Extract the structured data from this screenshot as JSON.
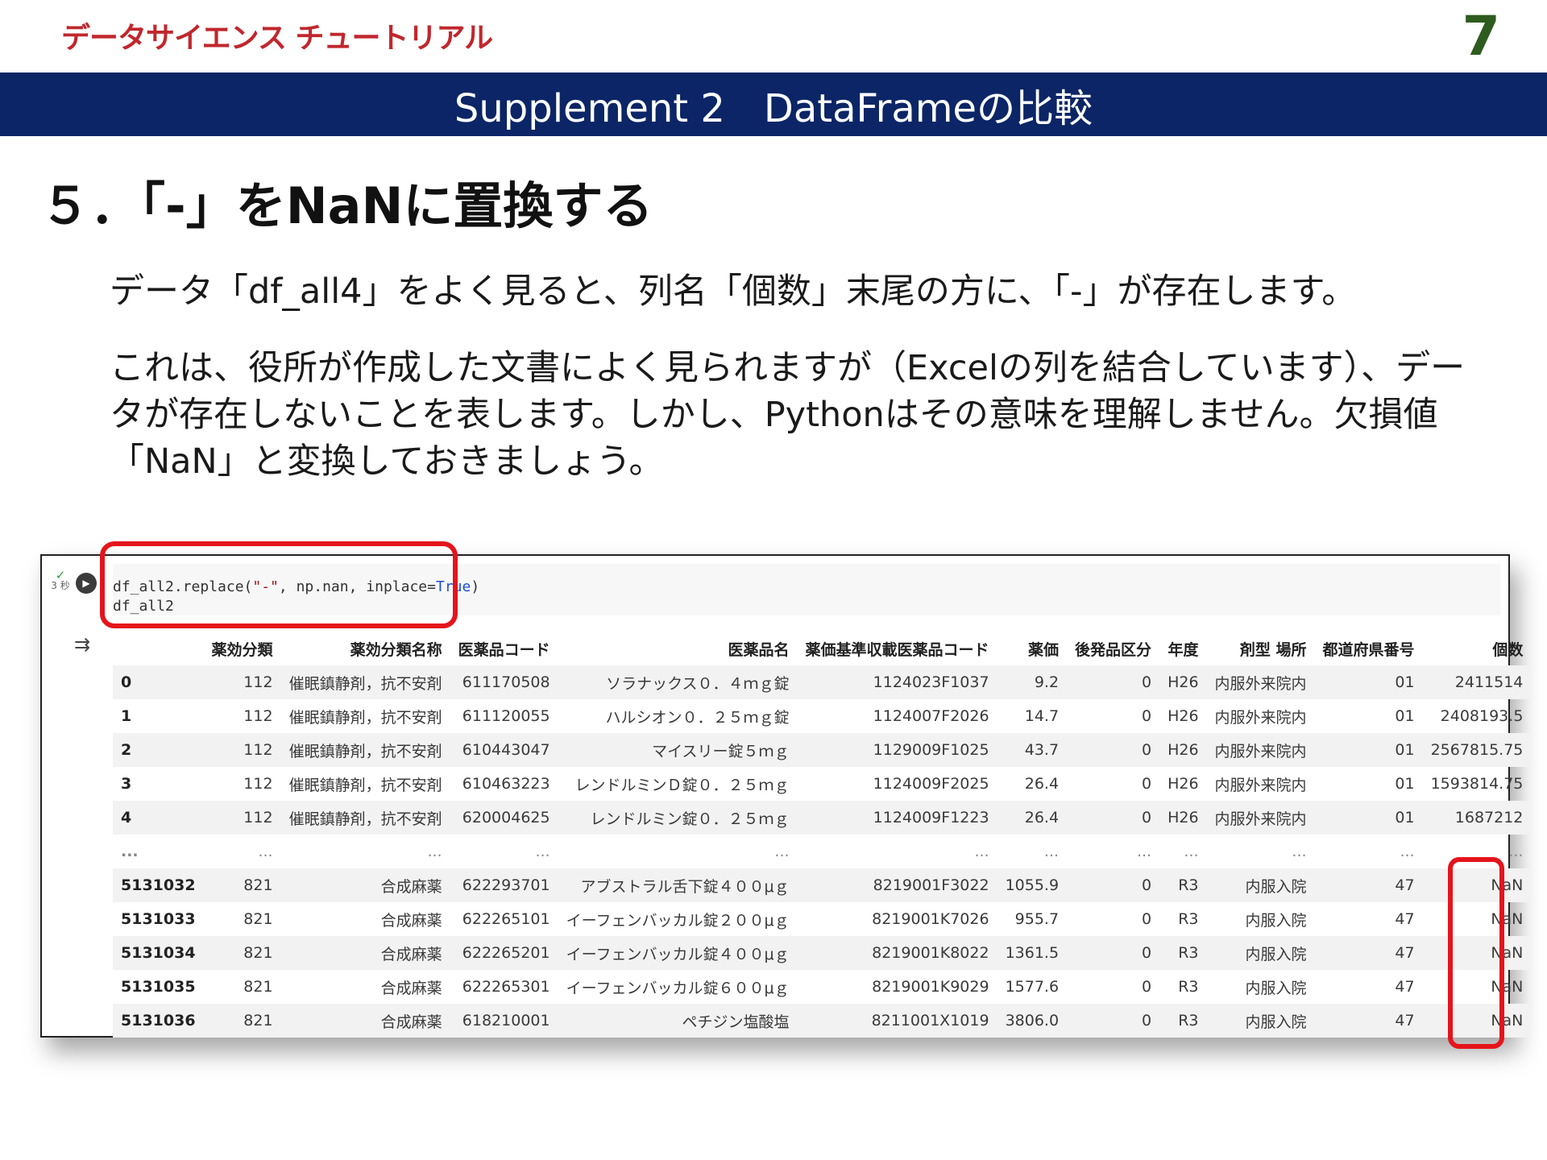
{
  "header": {
    "brand": "データサイエンス チュートリアル",
    "page_number": "7",
    "banner": "Supplement 2　DataFrameの比較"
  },
  "section": {
    "title": "５．「-」をNaNに置換する",
    "para1": "データ「df_all4」をよく見ると、列名「個数」末尾の方に、「-」が存在します。",
    "para2": "これは、役所が作成した文書によく見られますが（Excelの列を結合しています）、データが存在しないことを表します。しかし、Pythonはその意味を理解しません。欠損値「NaN」と変換しておきましょう。"
  },
  "cell": {
    "status_check": "✓",
    "status_time": "3 秒",
    "code_line1_a": "df_all2.replace(",
    "code_line1_str": "\"-\"",
    "code_line1_b": ", np.nan, inplace=",
    "code_line1_kw": "True",
    "code_line1_c": ")",
    "code_line2": "df_all2"
  },
  "table": {
    "columns": [
      "",
      "薬効分類",
      "薬効分類名称",
      "医薬品コード",
      "医薬品名",
      "薬価基準収載医薬品コード",
      "薬価",
      "後発品区分",
      "年度",
      "剤型 場所",
      "都道府県番号",
      "個数"
    ],
    "rows": [
      [
        "0",
        "112",
        "催眠鎮静剤，抗不安剤",
        "611170508",
        "ソラナックス０．４ｍｇ錠",
        "1124023F1037",
        "9.2",
        "0",
        "H26",
        "内服外来院内",
        "01",
        "2411514"
      ],
      [
        "1",
        "112",
        "催眠鎮静剤，抗不安剤",
        "611120055",
        "ハルシオン０．２５ｍｇ錠",
        "1124007F2026",
        "14.7",
        "0",
        "H26",
        "内服外来院内",
        "01",
        "2408193.5"
      ],
      [
        "2",
        "112",
        "催眠鎮静剤，抗不安剤",
        "610443047",
        "マイスリー錠５ｍｇ",
        "1129009F1025",
        "43.7",
        "0",
        "H26",
        "内服外来院内",
        "01",
        "2567815.75"
      ],
      [
        "3",
        "112",
        "催眠鎮静剤，抗不安剤",
        "610463223",
        "レンドルミンＤ錠０．２５ｍｇ",
        "1124009F2025",
        "26.4",
        "0",
        "H26",
        "内服外来院内",
        "01",
        "1593814.75"
      ],
      [
        "4",
        "112",
        "催眠鎮静剤，抗不安剤",
        "620004625",
        "レンドルミン錠０．２５ｍｇ",
        "1124009F1223",
        "26.4",
        "0",
        "H26",
        "内服外来院内",
        "01",
        "1687212"
      ],
      [
        "...",
        "...",
        "...",
        "...",
        "...",
        "...",
        "...",
        "...",
        "...",
        "...",
        "...",
        "..."
      ],
      [
        "5131032",
        "821",
        "合成麻薬",
        "622293701",
        "アブストラル舌下錠４００μｇ",
        "8219001F3022",
        "1055.9",
        "0",
        "R3",
        "内服入院",
        "47",
        "NaN"
      ],
      [
        "5131033",
        "821",
        "合成麻薬",
        "622265101",
        "イーフェンバッカル錠２００μｇ",
        "8219001K7026",
        "955.7",
        "0",
        "R3",
        "内服入院",
        "47",
        "NaN"
      ],
      [
        "5131034",
        "821",
        "合成麻薬",
        "622265201",
        "イーフェンバッカル錠４００μｇ",
        "8219001K8022",
        "1361.5",
        "0",
        "R3",
        "内服入院",
        "47",
        "NaN"
      ],
      [
        "5131035",
        "821",
        "合成麻薬",
        "622265301",
        "イーフェンバッカル錠６００μｇ",
        "8219001K9029",
        "1577.6",
        "0",
        "R3",
        "内服入院",
        "47",
        "NaN"
      ],
      [
        "5131036",
        "821",
        "合成麻薬",
        "618210001",
        "ペチジン塩酸塩",
        "8211001X1019",
        "3806.0",
        "0",
        "R3",
        "内服入院",
        "47",
        "NaN"
      ]
    ]
  }
}
